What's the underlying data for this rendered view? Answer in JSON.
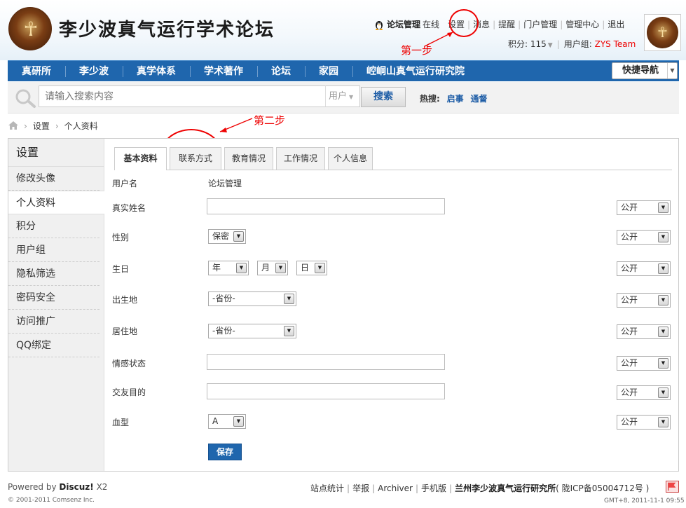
{
  "header": {
    "logo_glyph": "☥",
    "site_title": "李少波真气运行学术论坛",
    "user": {
      "name": "论坛管理",
      "status": "在线",
      "links": [
        "设置",
        "消息",
        "提醒",
        "门户管理",
        "管理中心",
        "退出"
      ],
      "credits_label": "积分: 115",
      "usergroup_label": "用户组:",
      "usergroup_value": "ZYS Team"
    },
    "annotations": {
      "step1": "第一步",
      "step2": "第二步"
    }
  },
  "nav": {
    "items": [
      "真研所",
      "李少波",
      "真学体系",
      "学术著作",
      "论坛",
      "家园",
      "崆峒山真气运行研究院"
    ],
    "quicknav_label": "快捷导航"
  },
  "search": {
    "placeholder": "请输入搜索内容",
    "type_label": "用户",
    "button_label": "搜索",
    "hot_label": "热搜:",
    "hot_terms": [
      "启事",
      "通督"
    ]
  },
  "breadcrumb": {
    "items": [
      "设置",
      "个人资料"
    ]
  },
  "sidebar": {
    "title": "设置",
    "items": [
      "修改头像",
      "个人资料",
      "积分",
      "用户组",
      "隐私筛选",
      "密码安全",
      "访问推广",
      "QQ绑定"
    ],
    "active_index": 1
  },
  "tabs": [
    "基本资料",
    "联系方式",
    "教育情况",
    "工作情况",
    "个人信息"
  ],
  "form": {
    "username_label": "用户名",
    "username_value": "论坛管理",
    "realname_label": "真实姓名",
    "gender_label": "性别",
    "gender_value": "保密",
    "birthday_label": "生日",
    "birth_year": "年",
    "birth_month": "月",
    "birth_day": "日",
    "birthplace_label": "出生地",
    "birthplace_value": "-省份-",
    "residence_label": "居住地",
    "residence_value": "-省份-",
    "emotion_label": "情感状态",
    "purpose_label": "交友目的",
    "bloodtype_label": "血型",
    "bloodtype_value": "A",
    "privacy_value": "公开",
    "save_label": "保存"
  },
  "footer": {
    "powered_prefix": "Powered by",
    "powered_name": "Discuz!",
    "powered_version": "X2",
    "copyright": "© 2001-2011 Comsenz Inc.",
    "links": [
      "站点统计",
      "举报",
      "Archiver",
      "手机版"
    ],
    "org": "兰州李少波真气运行研究所",
    "icp": "( 陇ICP备05004712号 )",
    "time": "GMT+8, 2011-11-1 09:55"
  }
}
